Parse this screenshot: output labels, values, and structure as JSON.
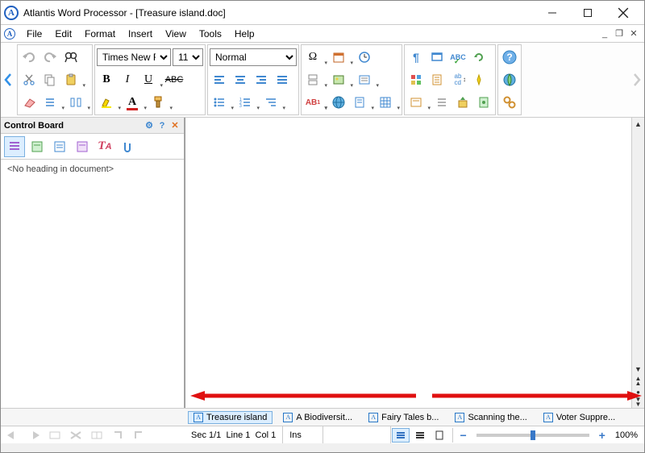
{
  "title": "Atlantis Word Processor - [Treasure island.doc]",
  "menu": [
    "File",
    "Edit",
    "Format",
    "Insert",
    "View",
    "Tools",
    "Help"
  ],
  "font": {
    "name": "Times New Ro",
    "size": "11",
    "style": "Normal"
  },
  "control_board": {
    "title": "Control Board",
    "body": "<No heading in document>"
  },
  "doc_tabs": [
    {
      "label": "Treasure island",
      "active": true
    },
    {
      "label": "A Biodiversit...",
      "active": false
    },
    {
      "label": "Fairy Tales b...",
      "active": false
    },
    {
      "label": "Scanning the...",
      "active": false
    },
    {
      "label": "Voter Suppre...",
      "active": false
    }
  ],
  "status": {
    "sec": "Sec 1/1",
    "line": "Line 1",
    "col": "Col 1",
    "ins": "Ins",
    "zoom": "100%"
  }
}
